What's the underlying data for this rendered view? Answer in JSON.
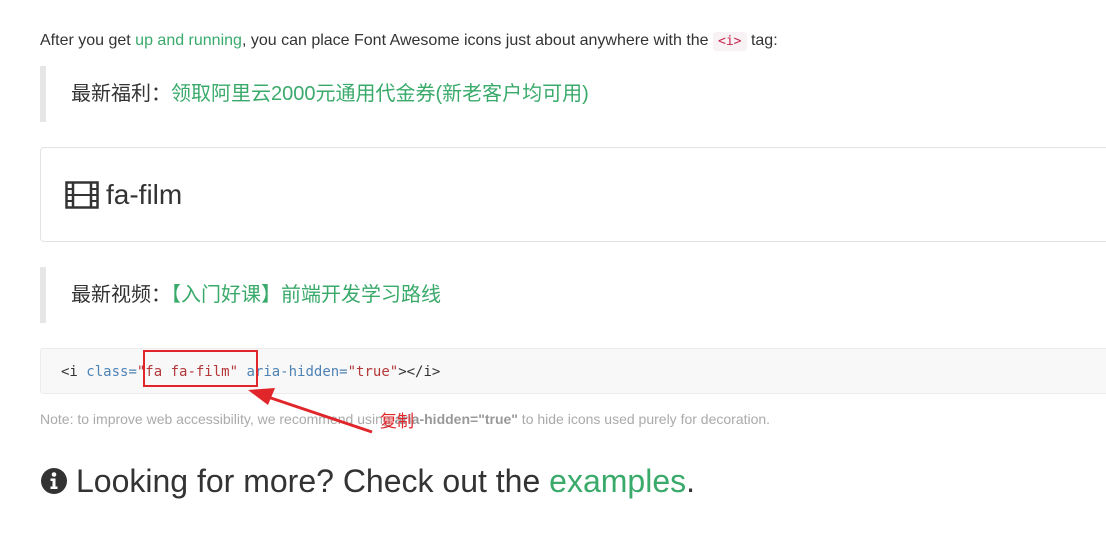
{
  "intro": {
    "before": "After you get ",
    "link": "up and running",
    "middle": ", you can place Font Awesome icons just about anywhere with the ",
    "code": "<i>",
    "after": " tag:"
  },
  "notice1": {
    "label": "最新福利：",
    "link": "领取阿里云2000元通用代金券(新老客户均可用)"
  },
  "icon_card": {
    "icon": "film-icon",
    "name": "fa-film"
  },
  "notice2": {
    "label": "最新视频：",
    "link": "【入门好课】前端开发学习路线"
  },
  "code": {
    "open": "<i ",
    "attr1": "class=",
    "val1": "\"fa fa-film\"",
    "space": " ",
    "attr2": "aria-hidden=",
    "val2": "\"true\"",
    "close": "></i>"
  },
  "annotation": {
    "label": "复制",
    "color": "#e0262a"
  },
  "note": {
    "before": "Note: to improve web accessibility, we recommend using ",
    "bold": "aria-hidden=\"true\"",
    "after": " to hide icons used purely for decoration."
  },
  "more": {
    "icon": "info-circle-icon",
    "text": "Looking for more? Check out the ",
    "link": "examples",
    "end": "."
  },
  "colors": {
    "link_green": "#3aaa6b",
    "annotation_red": "#e0262a"
  }
}
